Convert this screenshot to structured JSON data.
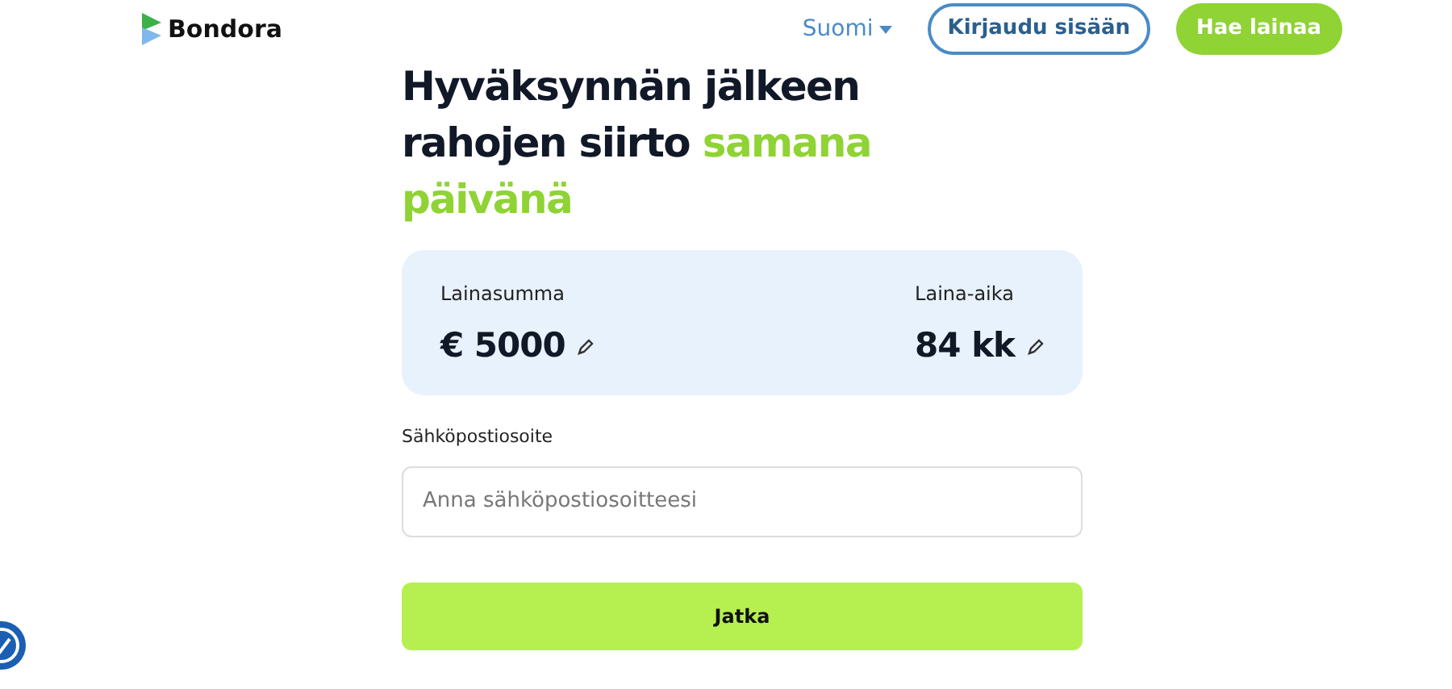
{
  "header": {
    "logo_text": "Bondora",
    "language": "Suomi",
    "login_button": "Kirjaudu sisään",
    "apply_button": "Hae lainaa"
  },
  "heading": [
    {
      "text": "Hyväksynnän jälkeen rahojen siirto ",
      "accent": false
    },
    {
      "text": "samana päivänä",
      "accent": true
    }
  ],
  "summary": {
    "items": [
      {
        "label": "Lainasumma",
        "value": "€ 5000"
      },
      {
        "label": "Laina-aika",
        "value": "84 kk"
      }
    ]
  },
  "email": {
    "label": "Sähköpostiosoite",
    "placeholder": "Anna sähköpostiosoitteesi"
  },
  "submit_button": "Jatka"
}
